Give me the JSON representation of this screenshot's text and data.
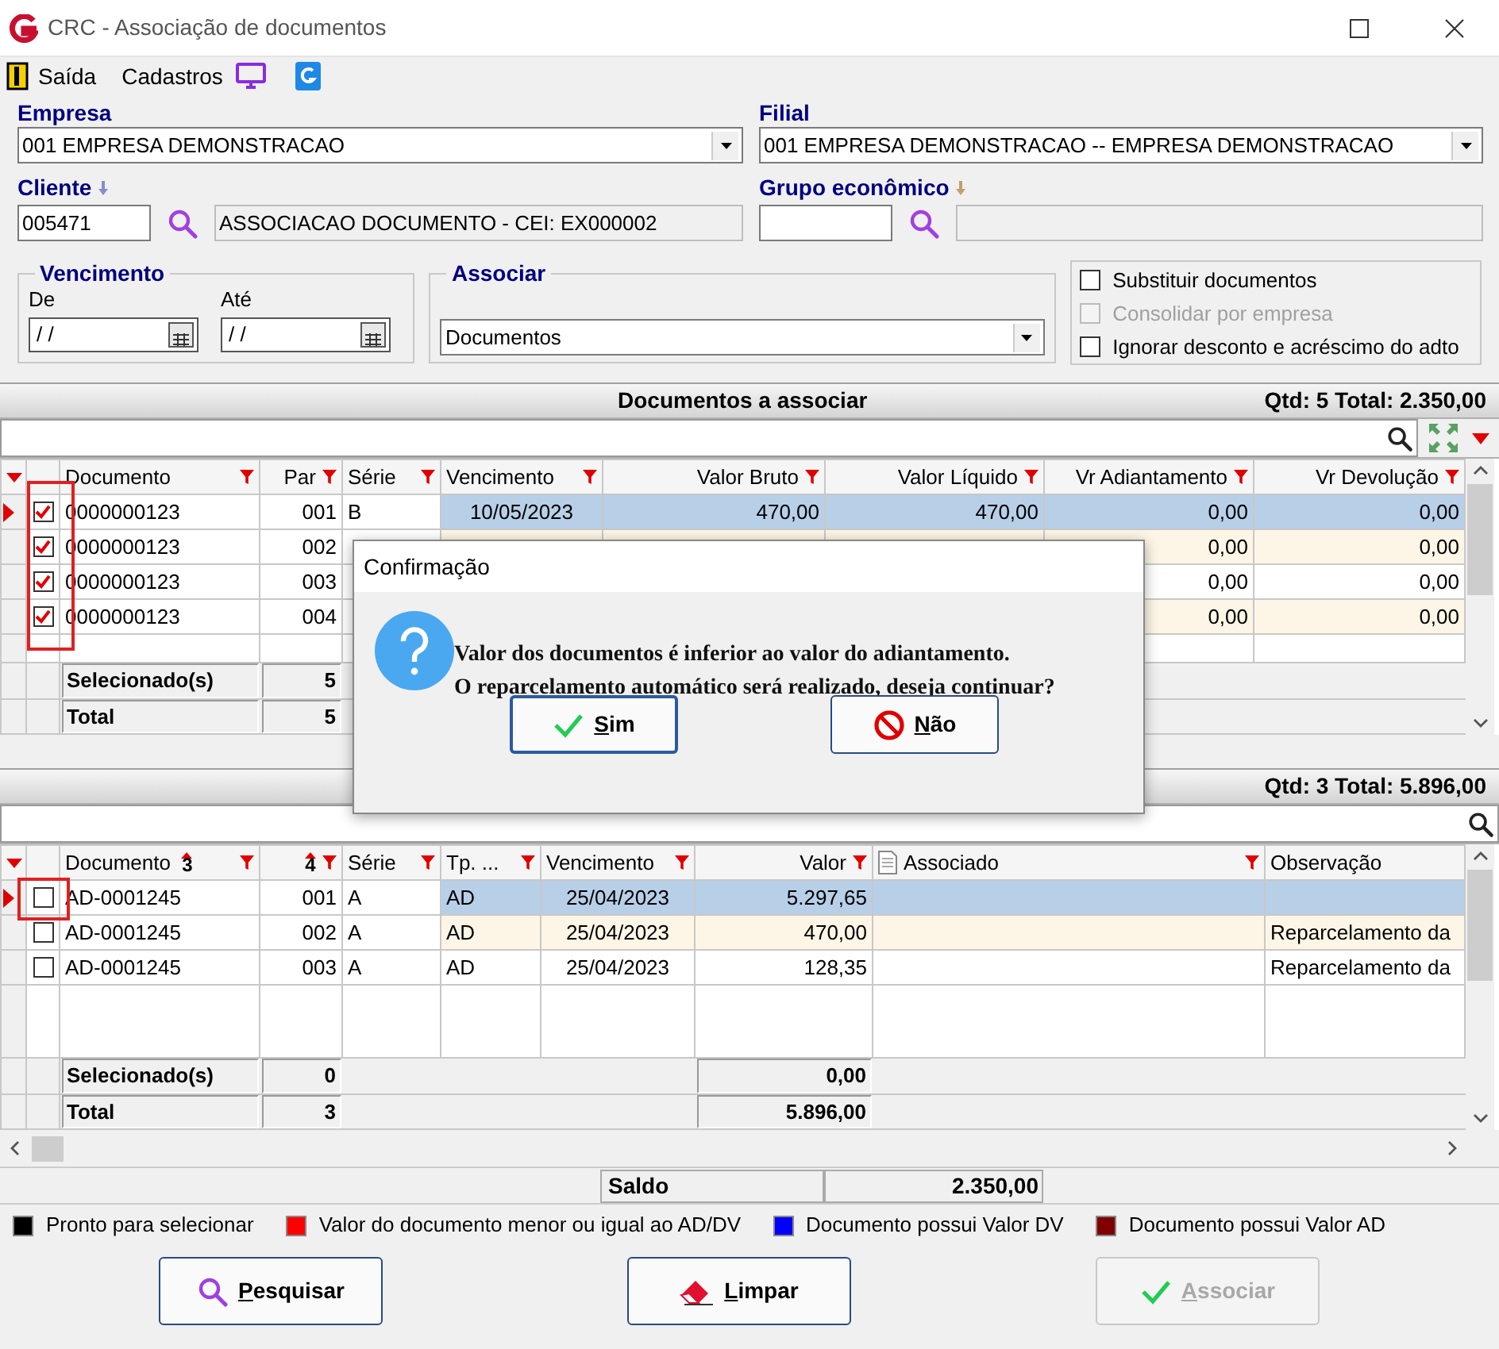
{
  "window": {
    "title": "CRC - Associação de documentos"
  },
  "toolbar": [
    {
      "kind": "exit",
      "label": "Saída"
    },
    {
      "kind": "menu",
      "label": "Cadastros"
    },
    {
      "kind": "monitor"
    },
    {
      "kind": "app"
    }
  ],
  "empresa": {
    "label": "Empresa",
    "value": "001 EMPRESA DEMONSTRACAO"
  },
  "filial": {
    "label": "Filial",
    "value": "001 EMPRESA DEMONSTRACAO -- EMPRESA DEMONSTRACAO"
  },
  "cliente": {
    "label": "Cliente",
    "code": "005471",
    "name": "ASSOCIACAO DOCUMENTO - CEI: EX000002"
  },
  "grupo_economico": {
    "label": "Grupo econômico"
  },
  "vencimento": {
    "title": "Vencimento",
    "de": {
      "label": "De",
      "value": "/ /"
    },
    "ate": {
      "label": "Até",
      "value": "/ /"
    }
  },
  "associar": {
    "title": "Associar",
    "value": "Documentos"
  },
  "options": [
    {
      "label": "Substituir documentos",
      "checked": false,
      "disabled": false
    },
    {
      "label": "Consolidar por empresa",
      "checked": false,
      "disabled": true
    },
    {
      "label": "Ignorar desconto e acréscimo do adto",
      "checked": false,
      "disabled": false
    }
  ],
  "top_table": {
    "title": "Documentos a associar",
    "summary": "Qtd: 5 Total: 2.350,00",
    "columns": [
      {
        "label": "Documento",
        "filter": true
      },
      {
        "label": "Par",
        "filter": true
      },
      {
        "label": "Série",
        "filter": true
      },
      {
        "label": "Vencimento",
        "filter": true
      },
      {
        "label": "Valor Bruto",
        "filter": true
      },
      {
        "label": "Valor Líquido",
        "filter": true
      },
      {
        "label": "Vr Adiantamento",
        "filter": true
      },
      {
        "label": "Vr Devolução",
        "filter": true
      }
    ],
    "rows": [
      {
        "checked": true,
        "selected": true,
        "cells": [
          "0000000123",
          "001",
          "B",
          "10/05/2023",
          "470,00",
          "470,00",
          "0,00",
          "0,00"
        ]
      },
      {
        "checked": true,
        "selected": false,
        "cells": [
          "0000000123",
          "002",
          null,
          null,
          null,
          null,
          "0,00",
          "0,00"
        ]
      },
      {
        "checked": true,
        "selected": false,
        "cells": [
          "0000000123",
          "003",
          null,
          null,
          null,
          null,
          "0,00",
          "0,00"
        ]
      },
      {
        "checked": true,
        "selected": false,
        "cells": [
          "0000000123",
          "004",
          null,
          null,
          null,
          null,
          "0,00",
          "0,00"
        ]
      }
    ],
    "footer": [
      {
        "label": "Selecionado(s)",
        "count": "5"
      },
      {
        "label": "Total",
        "count": "5"
      }
    ]
  },
  "bottom_table": {
    "summary": "Qtd: 3 Total: 5.896,00",
    "columns": [
      {
        "label": "Documento",
        "sort": "3",
        "filter": true
      },
      {
        "sort": "4",
        "filter": true
      },
      {
        "label": "Série",
        "filter": true
      },
      {
        "label": "Tp. ...",
        "filter": true
      },
      {
        "label": "Vencimento",
        "filter": true
      },
      {
        "label": "Valor",
        "filter": true
      },
      {
        "label": "Associado",
        "filter": true,
        "kind": "document"
      },
      {
        "label": "Observação",
        "filter": false
      }
    ],
    "rows": [
      {
        "checked": false,
        "selected": true,
        "cells": [
          "AD-0001245",
          "001",
          "A",
          "AD",
          "25/04/2023",
          "5.297,65",
          null,
          null
        ]
      },
      {
        "checked": false,
        "selected": false,
        "cells": [
          "AD-0001245",
          "002",
          "A",
          "AD",
          "25/04/2023",
          "470,00",
          null,
          "Reparcelamento da"
        ]
      },
      {
        "checked": false,
        "selected": false,
        "cells": [
          "AD-0001245",
          "003",
          "A",
          "AD",
          "25/04/2023",
          "128,35",
          null,
          "Reparcelamento da"
        ]
      }
    ],
    "footer": [
      {
        "label": "Selecionado(s)",
        "count": "0",
        "value": "0,00"
      },
      {
        "label": "Total",
        "count": "3",
        "value": "5.896,00"
      }
    ]
  },
  "saldo": {
    "label": "Saldo",
    "value": "2.350,00"
  },
  "legend": [
    {
      "label": "Pronto para selecionar",
      "color": "#000000"
    },
    {
      "label": "Valor do documento menor ou igual ao AD/DV",
      "color": "#ff0000"
    },
    {
      "label": "Documento possui Valor DV",
      "color": "#0000ff"
    },
    {
      "label": "Documento possui Valor AD",
      "color": "#800000"
    }
  ],
  "buttons": [
    {
      "kind": "search",
      "label": "Pesquisar",
      "disabled": false
    },
    {
      "kind": "clear",
      "label": "Limpar",
      "disabled": false
    },
    {
      "kind": "confirm",
      "label": "Associar",
      "disabled": true
    }
  ],
  "dialog": {
    "title": "Confirmação",
    "message": [
      "Valor dos documentos é inferior ao valor do adiantamento.",
      "O reparcelamento automático será realizado, deseja continuar?"
    ],
    "buttons": [
      {
        "kind": "yes",
        "label": "Sim"
      },
      {
        "kind": "no",
        "label": "Não"
      }
    ]
  }
}
